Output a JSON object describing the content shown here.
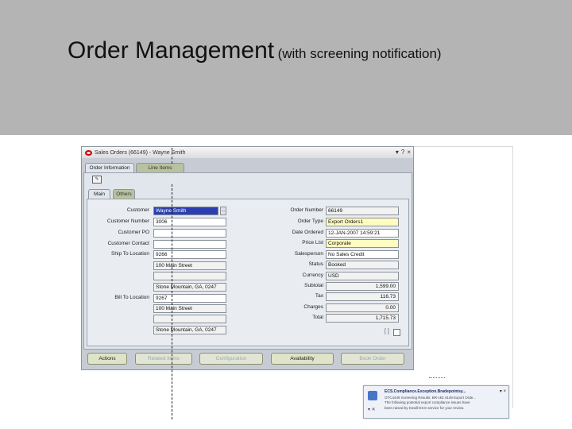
{
  "slide": {
    "title_main": "Order Management",
    "title_sub": "(with screening notification)"
  },
  "window": {
    "title": "Sales Orders (66149) - Wayne Smith",
    "controls": [
      "▾",
      "?",
      "×"
    ]
  },
  "tabs": {
    "primary": [
      "Order Information",
      "Line Items"
    ],
    "secondary": [
      "Main",
      "Others"
    ]
  },
  "form": {
    "customer_label": "Customer",
    "customer_value": "Wayne Smith",
    "customer_number_label": "Customer Number",
    "customer_number_value": "3006",
    "customer_po_label": "Customer PO",
    "customer_po_value": "",
    "customer_contact_label": "Customer Contact",
    "customer_contact_value": "",
    "ship_to_label": "Ship To Location",
    "ship_to_value": "9266",
    "ship_to_addr1": "100 Main Street",
    "ship_to_addr2": "",
    "ship_to_addr3": "Stone Mountain, GA, 0247",
    "bill_to_label": "Bill To Location",
    "bill_to_value": "9267",
    "bill_to_addr1": "100 Main Street",
    "bill_to_addr2": "",
    "bill_to_addr3": "Stone Mountain, GA, 0247",
    "order_number_label": "Order Number",
    "order_number_value": "66149",
    "order_type_label": "Order Type",
    "order_type_value": "Export Orders1",
    "date_ordered_label": "Date Ordered",
    "date_ordered_value": "12-JAN-2007 14:59:21",
    "price_list_label": "Price List",
    "price_list_value": "Corporate",
    "salesperson_label": "Salesperson",
    "salesperson_value": "No Sales Credit",
    "status_label": "Status",
    "status_value": "Booked",
    "currency_label": "Currency",
    "currency_value": "USD",
    "subtotal_label": "Subtotal",
    "subtotal_value": "1,599.00",
    "tax_label": "Tax",
    "tax_value": "116.73",
    "charges_label": "Charges",
    "charges_value": "0.00",
    "total_label": "Total",
    "total_value": "1,715.73"
  },
  "buttons": {
    "actions": "Actions",
    "related_items": "Related Items",
    "configuration": "Configuration",
    "availability": "Availability",
    "book_order": "Book Order"
  },
  "notification": {
    "title": "ECS.Compliance.Exception.Bradepointsy...",
    "line1": "OTC4449 Screening Results: BR-ck3 4149 Export Orde...",
    "line2": "The following potential export compliance issues have",
    "line3": "been raised by Kewill ECS service for your review.",
    "controls": "▾ ×"
  }
}
